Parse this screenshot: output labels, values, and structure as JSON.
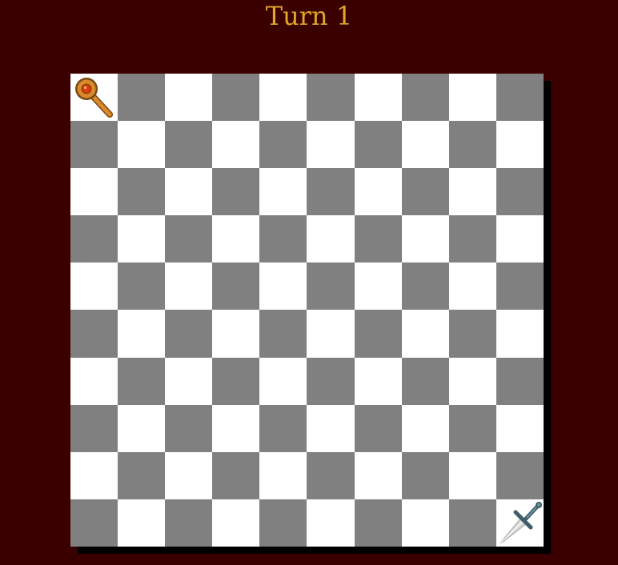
{
  "header": {
    "title": "Turn 1"
  },
  "board": {
    "rows": 10,
    "cols": 10,
    "light_color": "#ffffff",
    "dark_color": "#808080",
    "pieces": [
      {
        "name": "staff-piece",
        "icon": "staff-icon",
        "row": 0,
        "col": 0
      },
      {
        "name": "sword-piece",
        "icon": "sword-icon",
        "row": 9,
        "col": 9
      }
    ]
  }
}
